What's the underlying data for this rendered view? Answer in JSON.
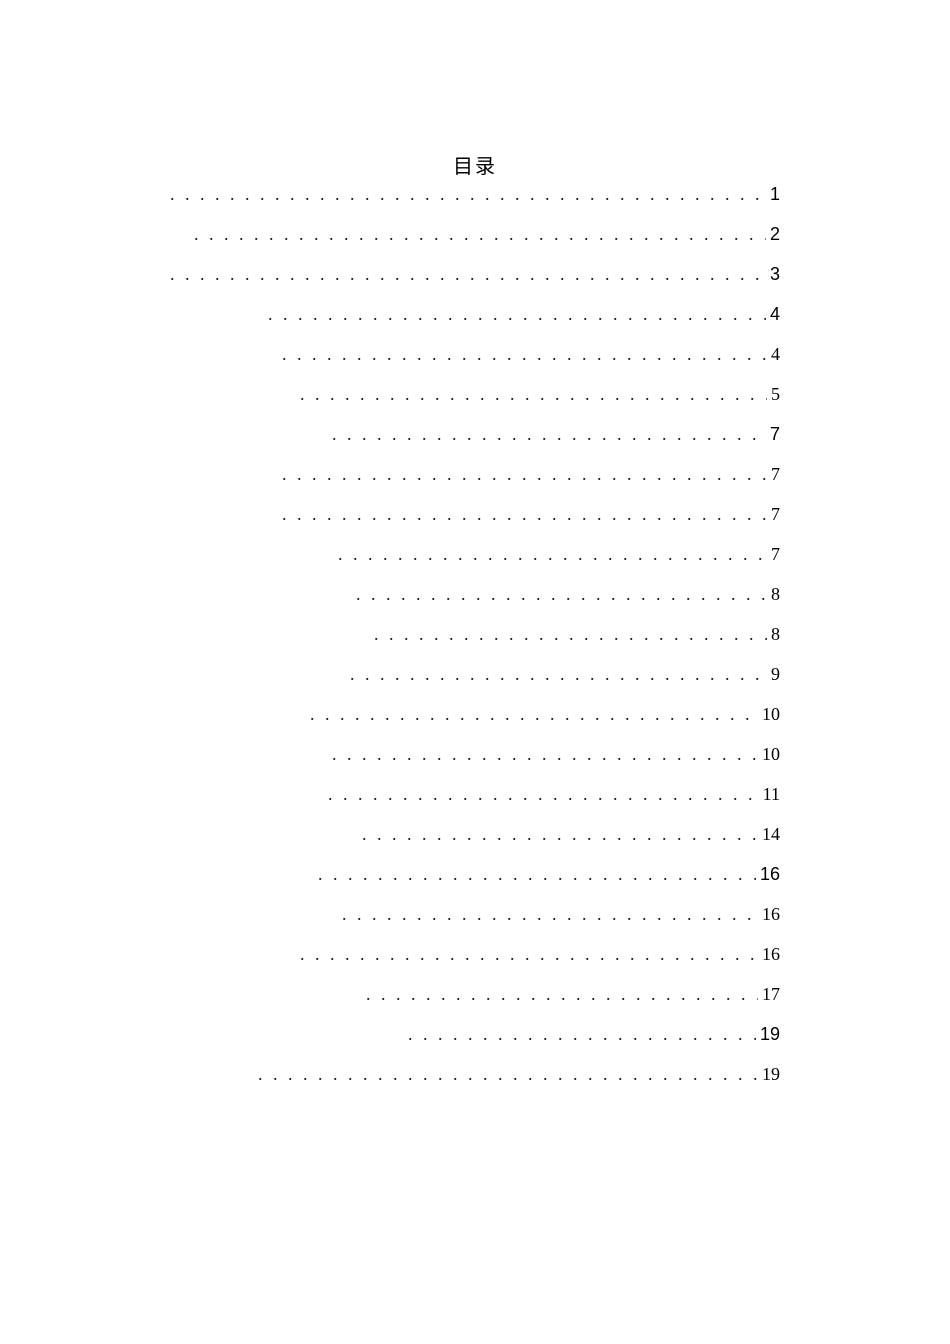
{
  "title": "目录",
  "entries": [
    {
      "label": "",
      "indent": 0,
      "page": "1",
      "page_sans": true
    },
    {
      "label": "",
      "indent": 24,
      "page": "2",
      "page_sans": true
    },
    {
      "label": "",
      "indent": 0,
      "page": "3",
      "page_sans": true
    },
    {
      "label": "",
      "indent": 98,
      "page": "4",
      "page_sans": true
    },
    {
      "label": "",
      "indent": 112,
      "page": "4",
      "page_sans": false
    },
    {
      "label": "",
      "indent": 130,
      "page": "5",
      "page_sans": false
    },
    {
      "label": "",
      "indent": 162,
      "page": "7",
      "page_sans": true
    },
    {
      "label": "",
      "indent": 112,
      "page": "7",
      "page_sans": false
    },
    {
      "label": "",
      "indent": 112,
      "page": "7",
      "page_sans": false
    },
    {
      "label": "",
      "indent": 168,
      "page": "7",
      "page_sans": false
    },
    {
      "label": "",
      "indent": 186,
      "page": "8",
      "page_sans": false
    },
    {
      "label": "",
      "indent": 204,
      "page": "8",
      "page_sans": false
    },
    {
      "label": "",
      "indent": 180,
      "page": "9",
      "page_sans": false
    },
    {
      "label": "",
      "indent": 140,
      "page": "10",
      "page_sans": false
    },
    {
      "label": "",
      "indent": 162,
      "page": "10",
      "page_sans": false
    },
    {
      "label": "",
      "indent": 158,
      "page": "11",
      "page_sans": false
    },
    {
      "label": "",
      "indent": 192,
      "page": "14",
      "page_sans": false
    },
    {
      "label": "",
      "indent": 148,
      "page": "16",
      "page_sans": true
    },
    {
      "label": "",
      "indent": 172,
      "page": "16",
      "page_sans": false
    },
    {
      "label": "",
      "indent": 130,
      "page": "16",
      "page_sans": false
    },
    {
      "label": "",
      "indent": 196,
      "page": "17",
      "page_sans": false
    },
    {
      "label": "",
      "indent": 238,
      "page": "19",
      "page_sans": true
    },
    {
      "label": "",
      "indent": 88,
      "page": "19",
      "page_sans": false
    }
  ]
}
